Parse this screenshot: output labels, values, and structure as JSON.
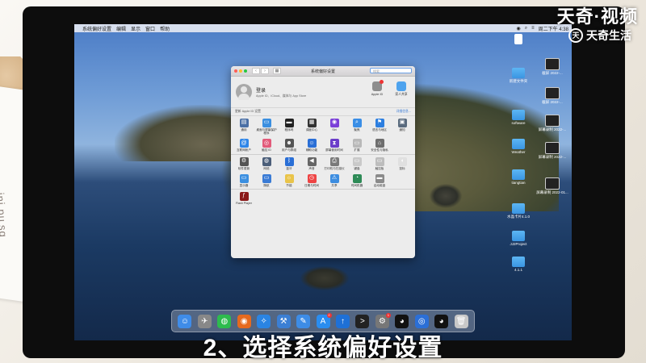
{
  "watermark": {
    "brand": "天奇·视频",
    "sub": "天奇生活"
  },
  "caption": "2、选择系统偏好设置",
  "paper_text": "ini pu sg",
  "menubar": {
    "items": [
      "系统偏好设置",
      "编辑",
      "显示",
      "窗口",
      "帮助"
    ],
    "right": [
      "◉",
      "⌕",
      "≡",
      "周二下午 4:38"
    ]
  },
  "desktop_icons": [
    {
      "label": "",
      "kind": "pdf"
    },
    {
      "label": "截屏 2022-...",
      "kind": "shot"
    },
    {
      "label": "新建文件夹",
      "kind": "folder"
    },
    {
      "label": "截屏 2022-...",
      "kind": "shot"
    },
    {
      "label": "software",
      "kind": "folder"
    },
    {
      "label": "屏幕录制 2022-...",
      "kind": "shot"
    },
    {
      "label": "Weather",
      "kind": "folder"
    },
    {
      "label": "屏幕录制 2022-...",
      "kind": "shot"
    },
    {
      "label": "tiangtian",
      "kind": "folder"
    },
    {
      "label": "屏幕录制 2022-01...",
      "kind": "shot"
    },
    {
      "label": "水晶卡片4.1.0",
      "kind": "folder"
    },
    {
      "label": "JJ2Project",
      "kind": "folder"
    },
    {
      "label": "4.1.1",
      "kind": "folder"
    }
  ],
  "window": {
    "title": "系统偏好设置",
    "search_placeholder": "搜索",
    "account": {
      "name": "登录",
      "sub": "Apple ID、iCloud、媒体与 App Store",
      "apple_id_label": "Apple ID",
      "family_label": "家人共享"
    },
    "update": {
      "text": "更新 Apple ID 设置",
      "link": "详细信息..."
    },
    "row1": [
      {
        "label": "通用",
        "icon": "general-icon",
        "color": "#4a6fa5",
        "glyph": "▤"
      },
      {
        "label": "桌面与屏幕保护程序",
        "icon": "desktop-icon",
        "color": "#3b8fe0",
        "glyph": "▭"
      },
      {
        "label": "程序坞",
        "icon": "dock-icon",
        "color": "#222",
        "glyph": "▬"
      },
      {
        "label": "调度中心",
        "icon": "mission-control-icon",
        "color": "#333",
        "glyph": "▦"
      },
      {
        "label": "Siri",
        "icon": "siri-icon",
        "color": "#7b3fd8",
        "glyph": "◉"
      },
      {
        "label": "聚焦",
        "icon": "spotlight-icon",
        "color": "#3a8ee6",
        "glyph": "⌕"
      },
      {
        "label": "语言与地区",
        "icon": "language-icon",
        "color": "#2d7fe0",
        "glyph": "⚑"
      },
      {
        "label": "通知",
        "icon": "notifications-icon",
        "color": "#5a6b7e",
        "glyph": "▣"
      }
    ],
    "row2": [
      {
        "label": "互联网帐户",
        "icon": "internet-accounts-icon",
        "color": "#2f86e8",
        "glyph": "@"
      },
      {
        "label": "触控 ID",
        "icon": "touch-id-icon",
        "color": "#e25b7a",
        "glyph": "◎"
      },
      {
        "label": "用户与群组",
        "icon": "users-icon",
        "color": "#555",
        "glyph": "☻"
      },
      {
        "label": "辅助功能",
        "icon": "accessibility-icon",
        "color": "#2a6fd6",
        "glyph": "☺"
      },
      {
        "label": "屏幕使用时间",
        "icon": "screen-time-icon",
        "color": "#6b3dc9",
        "glyph": "⧗"
      },
      {
        "label": "扩展",
        "icon": "extensions-icon",
        "color": "#b9b9b9",
        "glyph": "▭"
      },
      {
        "label": "安全性与隐私",
        "icon": "security-icon",
        "color": "#6e6e6e",
        "glyph": "⌂"
      },
      {
        "label": "",
        "icon": "blank-icon",
        "color": "transparent",
        "glyph": ""
      }
    ],
    "row3": [
      {
        "label": "软件更新",
        "icon": "software-update-icon",
        "color": "#555",
        "glyph": "⚙"
      },
      {
        "label": "网络",
        "icon": "network-icon",
        "color": "#4b5e79",
        "glyph": "◍"
      },
      {
        "label": "蓝牙",
        "icon": "bluetooth-icon",
        "color": "#2a6fd6",
        "glyph": "ᛒ"
      },
      {
        "label": "声音",
        "icon": "sound-icon",
        "color": "#666",
        "glyph": "◀"
      },
      {
        "label": "打印机与扫描仪",
        "icon": "printer-icon",
        "color": "#7a7a7a",
        "glyph": "⎙"
      },
      {
        "label": "键盘",
        "icon": "keyboard-icon",
        "color": "#c9c9c9",
        "glyph": "▭"
      },
      {
        "label": "触控板",
        "icon": "trackpad-icon",
        "color": "#bdbdbd",
        "glyph": "▭"
      },
      {
        "label": "鼠标",
        "icon": "mouse-icon",
        "color": "#e0e0e0",
        "glyph": "◖"
      }
    ],
    "row4": [
      {
        "label": "显示器",
        "icon": "displays-icon",
        "color": "#3b8fe0",
        "glyph": "▭"
      },
      {
        "label": "随航",
        "icon": "sidecar-icon",
        "color": "#3a7bd5",
        "glyph": "▭"
      },
      {
        "label": "节能",
        "icon": "energy-icon",
        "color": "#e9c44a",
        "glyph": "☼"
      },
      {
        "label": "日期与时间",
        "icon": "date-time-icon",
        "color": "#e44",
        "glyph": "◷"
      },
      {
        "label": "共享",
        "icon": "sharing-icon",
        "color": "#3d8de0",
        "glyph": "⚠"
      },
      {
        "label": "时间机器",
        "icon": "time-machine-icon",
        "color": "#2e8b57",
        "glyph": "◔"
      },
      {
        "label": "启动磁盘",
        "icon": "startup-disk-icon",
        "color": "#8a8a8a",
        "glyph": "▬"
      },
      {
        "label": "",
        "icon": "blank-icon",
        "color": "transparent",
        "glyph": ""
      }
    ],
    "row5": [
      {
        "label": "Flash Player",
        "icon": "flash-player-icon",
        "color": "#8b1a1a",
        "glyph": "ƒ"
      }
    ]
  },
  "dock": [
    {
      "name": "finder-icon",
      "color": "#3f8ce8",
      "glyph": "☺"
    },
    {
      "name": "launchpad-icon",
      "color": "#888",
      "glyph": "✈"
    },
    {
      "name": "wechat-icon",
      "color": "#2dbb4e",
      "glyph": "◍"
    },
    {
      "name": "firefox-icon",
      "color": "#e66a1e",
      "glyph": "◉"
    },
    {
      "name": "safari-icon",
      "color": "#2a84e3",
      "glyph": "✧"
    },
    {
      "name": "xcode-icon",
      "color": "#3b7fd4",
      "glyph": "⚒"
    },
    {
      "name": "notes-icon",
      "color": "#3d8ce6",
      "glyph": "✎"
    },
    {
      "name": "app-store-icon",
      "color": "#2a8df0",
      "glyph": "A",
      "badge": "2"
    },
    {
      "name": "upload-icon",
      "color": "#1e70d6",
      "glyph": "↑"
    },
    {
      "name": "terminal-icon",
      "color": "#222",
      "glyph": ">"
    },
    {
      "name": "system-preferences-icon",
      "color": "#777",
      "glyph": "⚙",
      "badge": "1"
    },
    {
      "name": "qq-icon",
      "color": "#111",
      "glyph": "◕"
    },
    {
      "name": "browser-icon",
      "color": "#2b6fd6",
      "glyph": "◎"
    },
    {
      "name": "qq-2-icon",
      "color": "#111",
      "glyph": "◕"
    },
    {
      "name": "trash-icon",
      "color": "#c8c8c8",
      "glyph": "🗑"
    }
  ]
}
